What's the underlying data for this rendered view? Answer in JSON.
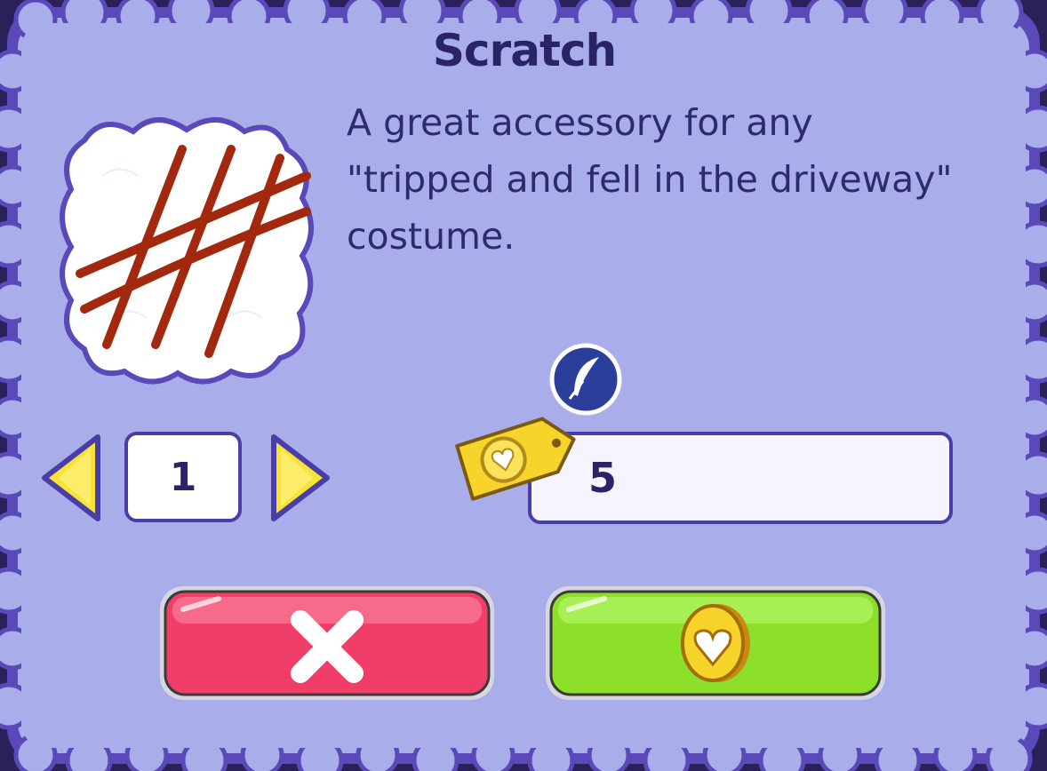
{
  "item": {
    "title": "Scratch",
    "description": "A great accessory for any\n\"tripped and fell in the driveway\"\ncostume."
  },
  "quantity": {
    "value": "1"
  },
  "price": {
    "value": "5"
  },
  "icons": {
    "item_image": "scratch-marks-icon",
    "currency_badge": "feather-quill-icon",
    "price_tag": "heart-coin-tag-icon",
    "decrease": "arrow-left-icon",
    "increase": "arrow-right-icon",
    "cancel": "close-x-icon",
    "confirm": "heart-coin-icon"
  },
  "colors": {
    "panel": "#a9aeea",
    "border": "#5a49b8",
    "cancel_button": "#f03e68",
    "buy_button": "#8de02a",
    "arrow": "#f6e33a",
    "title": "#2b2368"
  }
}
